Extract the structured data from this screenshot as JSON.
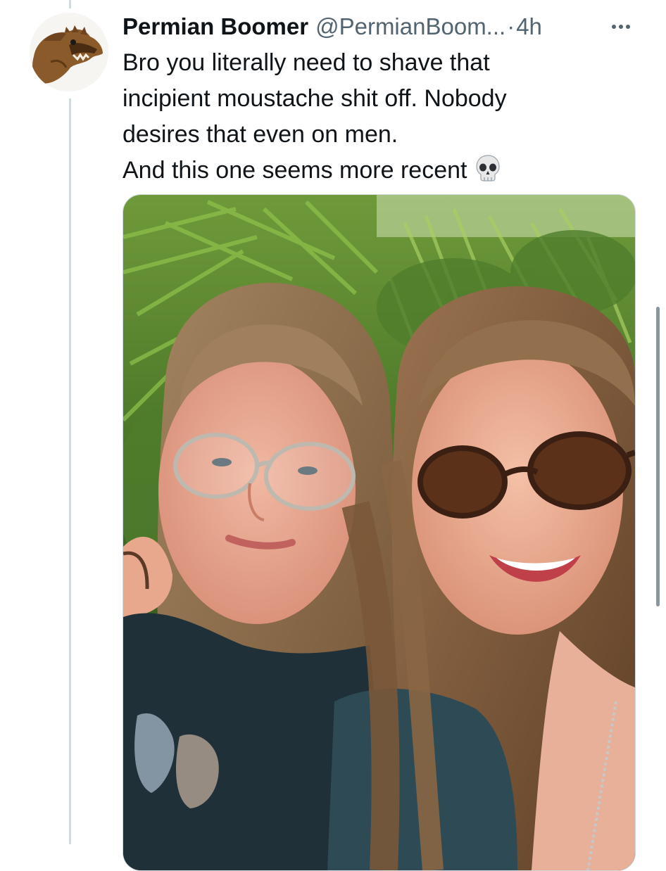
{
  "tweet": {
    "display_name": "Permian Boomer",
    "handle": "@PermianBoom...",
    "separator": "·",
    "timestamp": "4h",
    "more_label": "···",
    "text_lines": [
      "Bro you literally need to shave that",
      "incipient moustache shit off. Nobody",
      "desires that even on men.",
      "And this one seems more recent"
    ],
    "emoji": "skull-icon",
    "media": "photo of two smiling women taking a selfie in front of palm foliage"
  },
  "colors": {
    "text_primary": "#0f1419",
    "text_secondary": "#536471",
    "thread_line": "#cfd9de",
    "scrollbar": "#8b959e"
  }
}
